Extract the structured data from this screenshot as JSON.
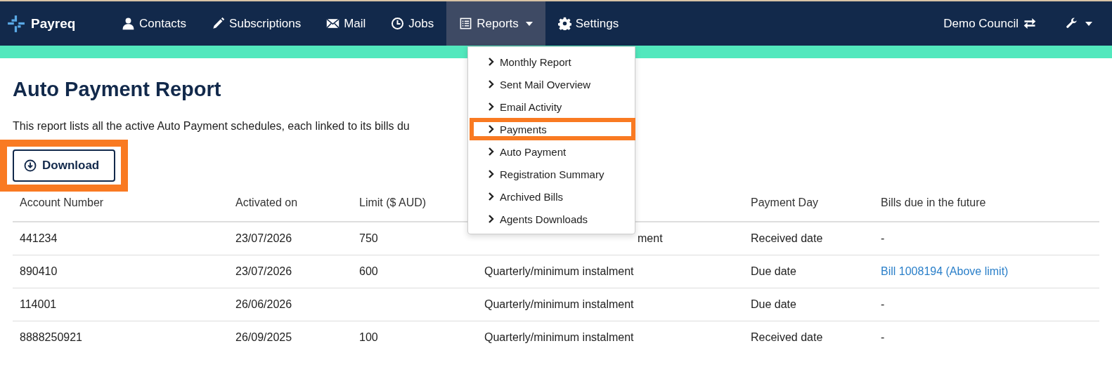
{
  "nav": {
    "brand": "Payreq",
    "items": [
      {
        "label": "Contacts",
        "selected": false,
        "dropdown": false
      },
      {
        "label": "Subscriptions",
        "selected": false,
        "dropdown": false
      },
      {
        "label": "Mail",
        "selected": false,
        "dropdown": false
      },
      {
        "label": "Jobs",
        "selected": false,
        "dropdown": false
      },
      {
        "label": "Reports",
        "selected": true,
        "dropdown": true
      },
      {
        "label": "Settings",
        "selected": false,
        "dropdown": false
      }
    ],
    "organisation": "Demo Council"
  },
  "menu": {
    "items": [
      {
        "label": "Monthly Report",
        "highlighted": false
      },
      {
        "label": "Sent Mail Overview",
        "highlighted": false
      },
      {
        "label": "Email Activity",
        "highlighted": false
      },
      {
        "label": "Payments",
        "highlighted": true
      },
      {
        "label": "Auto Payment",
        "highlighted": false
      },
      {
        "label": "Registration Summary",
        "highlighted": false
      },
      {
        "label": "Archived Bills",
        "highlighted": false
      },
      {
        "label": "Agents Downloads",
        "highlighted": false
      }
    ]
  },
  "page": {
    "title": "Auto Payment Report",
    "description": "This report lists all the active Auto Payment schedules, each linked to its bills du",
    "download": {
      "label": "Download",
      "highlighted": true
    }
  },
  "table": {
    "columns": [
      "Account Number",
      "Activated on",
      "Limit ($ AUD)",
      null,
      "Payment Day",
      "Bills due in the future"
    ],
    "rows": [
      [
        "441234",
        "23/07/2026",
        "750",
        {
          "kind": "clipped",
          "text": "ment"
        },
        "Received date",
        "-"
      ],
      [
        "890410",
        "23/07/2026",
        "600",
        "Quarterly/minimum instalment",
        "Due date",
        {
          "kind": "link",
          "text": "Bill 1008194 (Above limit)"
        }
      ],
      [
        "114001",
        "26/06/2026",
        null,
        "Quarterly/minimum instalment",
        "Due date",
        "-"
      ],
      [
        "8888250921",
        "26/09/2025",
        "100",
        "Quarterly/minimum instalment",
        "Received date",
        "-"
      ]
    ]
  }
}
